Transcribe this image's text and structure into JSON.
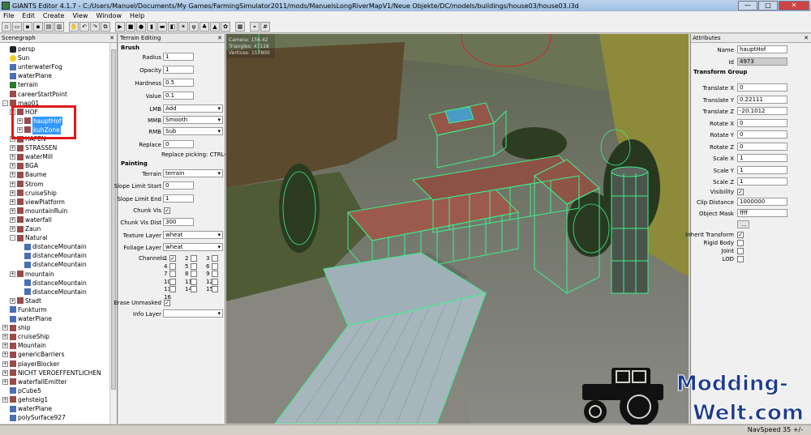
{
  "window": {
    "title": "GIANTS Editor 4.1.7 - C:/Users/Manuel/Documents/My Games/FarmingSimulator2011/mods/ManuelsLongRiverMapV1/Neue Objekte/DC/models/buildings/house03/house03.i3d",
    "minimize": "—",
    "maximize": "□",
    "close": "✕"
  },
  "menu": [
    "File",
    "Edit",
    "Create",
    "View",
    "Window",
    "Help"
  ],
  "scenegraph": {
    "title": "Scenegraph",
    "close": "✕",
    "nodes": [
      {
        "label": "persp",
        "indent": 0,
        "icon": "camera-icon"
      },
      {
        "label": "Sun",
        "indent": 0,
        "icon": "sun-icon"
      },
      {
        "label": "unterwaterFog",
        "indent": 0,
        "icon": "cube-icon"
      },
      {
        "label": "waterPlane",
        "indent": 0,
        "icon": "cube-icon"
      },
      {
        "label": "terrain",
        "indent": 0,
        "icon": "terrain-icon"
      },
      {
        "label": "careerStartPoint",
        "indent": 0,
        "icon": "transform-icon"
      },
      {
        "label": "map01",
        "indent": 0,
        "icon": "transform-icon",
        "expand": "-"
      },
      {
        "label": "HOF",
        "indent": 1,
        "icon": "transform-icon",
        "expand": "-"
      },
      {
        "label": "hauptHof",
        "indent": 2,
        "icon": "transform-icon",
        "expand": "+",
        "selected": true
      },
      {
        "label": "kuhZone",
        "indent": 2,
        "icon": "transform-icon",
        "expand": "+",
        "selected": true
      },
      {
        "label": "HAFEN",
        "indent": 1,
        "icon": "transform-icon",
        "expand": "+"
      },
      {
        "label": "STRASSEN",
        "indent": 1,
        "icon": "transform-icon",
        "expand": "+"
      },
      {
        "label": "waterMill",
        "indent": 1,
        "icon": "transform-icon",
        "expand": "+"
      },
      {
        "label": "BGA",
        "indent": 1,
        "icon": "transform-icon",
        "expand": "+"
      },
      {
        "label": "Baume",
        "indent": 1,
        "icon": "transform-icon",
        "expand": "+"
      },
      {
        "label": "Strom",
        "indent": 1,
        "icon": "transform-icon",
        "expand": "+"
      },
      {
        "label": "cruiseShip",
        "indent": 1,
        "icon": "transform-icon",
        "expand": "+"
      },
      {
        "label": "viewPlatform",
        "indent": 1,
        "icon": "transform-icon",
        "expand": "+"
      },
      {
        "label": "mountainRuin",
        "indent": 1,
        "icon": "transform-icon",
        "expand": "+"
      },
      {
        "label": "waterfall",
        "indent": 1,
        "icon": "transform-icon",
        "expand": "+"
      },
      {
        "label": "Zaun",
        "indent": 1,
        "icon": "transform-icon",
        "expand": "+"
      },
      {
        "label": "Natural",
        "indent": 1,
        "icon": "transform-icon",
        "expand": "-"
      },
      {
        "label": "distanceMountain",
        "indent": 2,
        "icon": "cube-icon"
      },
      {
        "label": "distanceMountain",
        "indent": 2,
        "icon": "cube-icon"
      },
      {
        "label": "distanceMountain",
        "indent": 2,
        "icon": "cube-icon"
      },
      {
        "label": "mountain",
        "indent": 1,
        "icon": "transform-icon",
        "expand": "+"
      },
      {
        "label": "distanceMountain",
        "indent": 2,
        "icon": "cube-icon"
      },
      {
        "label": "distanceMountain",
        "indent": 2,
        "icon": "cube-icon"
      },
      {
        "label": "Stadt",
        "indent": 1,
        "icon": "transform-icon",
        "expand": "+"
      },
      {
        "label": "Funkturm",
        "indent": 0,
        "icon": "cube-icon"
      },
      {
        "label": "waterPlane",
        "indent": 0,
        "icon": "cube-icon"
      },
      {
        "label": "ship",
        "indent": 0,
        "icon": "transform-icon",
        "expand": "+"
      },
      {
        "label": "cruiseShip",
        "indent": 0,
        "icon": "transform-icon",
        "expand": "+"
      },
      {
        "label": "Mountain",
        "indent": 0,
        "icon": "transform-icon",
        "expand": "+"
      },
      {
        "label": "genericBarriers",
        "indent": 0,
        "icon": "transform-icon",
        "expand": "+"
      },
      {
        "label": "playerBlocker",
        "indent": 0,
        "icon": "transform-icon",
        "expand": "+"
      },
      {
        "label": "NICHT VEROEFFENTLICHEN",
        "indent": 0,
        "icon": "transform-icon",
        "expand": "+"
      },
      {
        "label": "waterfallEmitter",
        "indent": 0,
        "icon": "transform-icon",
        "expand": "+"
      },
      {
        "label": "pCube5",
        "indent": 0,
        "icon": "cube-icon"
      },
      {
        "label": "gehsteig1",
        "indent": 0,
        "icon": "transform-icon",
        "expand": "+"
      },
      {
        "label": "waterPlane",
        "indent": 0,
        "icon": "cube-icon"
      },
      {
        "label": "polySurface927",
        "indent": 0,
        "icon": "cube-icon"
      }
    ]
  },
  "terrain": {
    "title": "Terrain Editing",
    "close": "✕",
    "brush": "Brush",
    "radius_label": "Radius",
    "radius": "1",
    "opacity_label": "Opacity",
    "opacity": "1",
    "hardness_label": "Hardness",
    "hardness": "0.5",
    "value_label": "Value",
    "value": "0.1",
    "lmb_label": "LMB",
    "lmb": "Add",
    "mmb_label": "MMB",
    "mmb": "Smooth",
    "rmb_label": "RMB",
    "rmb": "Sub",
    "replace_label": "Replace",
    "replace": "0",
    "replace_picking": "Replace picking: CTRL-R",
    "painting": "Painting",
    "terrain_label": "Terrain",
    "terrain_val": "terrain",
    "slope_start_label": "Slope Limit Start",
    "slope_start": "0",
    "slope_end_label": "Slope Limit End",
    "slope_end": "1",
    "chunk_vis_label": "Chunk Vis",
    "chunk_dist_label": "Chunk Vis Dist",
    "chunk_dist": "300",
    "texture_label": "Texture Layer",
    "texture": "wheat",
    "foliage_label": "Foliage Layer",
    "foliage": "wheat",
    "channels_label": "Channels",
    "channels": [
      "1",
      "2",
      "3",
      "4",
      "5",
      "6",
      "7",
      "8",
      "9",
      "10",
      "11",
      "12",
      "13",
      "14",
      "15",
      "16"
    ],
    "erase_label": "Erase Unmasked",
    "info_label": "Info Layer"
  },
  "viewport": {
    "stats": [
      "Camera: 156.42",
      "Triangles: 47118",
      "Vertices: 157800"
    ]
  },
  "attributes": {
    "title": "Attributes",
    "close": "✕",
    "name_label": "Name",
    "name": "hauptHof",
    "id_label": "Id",
    "id": "4973",
    "transform_group": "Transform Group",
    "rows": [
      {
        "label": "Translate X",
        "value": "0"
      },
      {
        "label": "Translate Y",
        "value": "0.22111"
      },
      {
        "label": "Translate Z",
        "value": "-20.1012"
      },
      {
        "label": "Rotate X",
        "value": "0"
      },
      {
        "label": "Rotate Y",
        "value": "0"
      },
      {
        "label": "Rotate Z",
        "value": "0"
      },
      {
        "label": "Scale X",
        "value": "1"
      },
      {
        "label": "Scale Y",
        "value": "1"
      },
      {
        "label": "Scale Z",
        "value": "1"
      }
    ],
    "visibility_label": "Visibility",
    "clip_label": "Clip Distance",
    "clip": "1000000",
    "mask_label": "Object Mask",
    "mask": "ffff",
    "browse": "...",
    "inherit_label": "Inherit Transform",
    "rigid_label": "Rigid Body",
    "joint_label": "Joint",
    "lod_label": "LOD"
  },
  "status": {
    "navspeed": "NavSpeed 35 +/-"
  },
  "watermark": {
    "line1": "Modding-",
    "line2": "Welt.com"
  },
  "colors": {
    "selection": "#3399ff",
    "highlight_box": "#e01818",
    "wireframe": "#3cf08c"
  }
}
